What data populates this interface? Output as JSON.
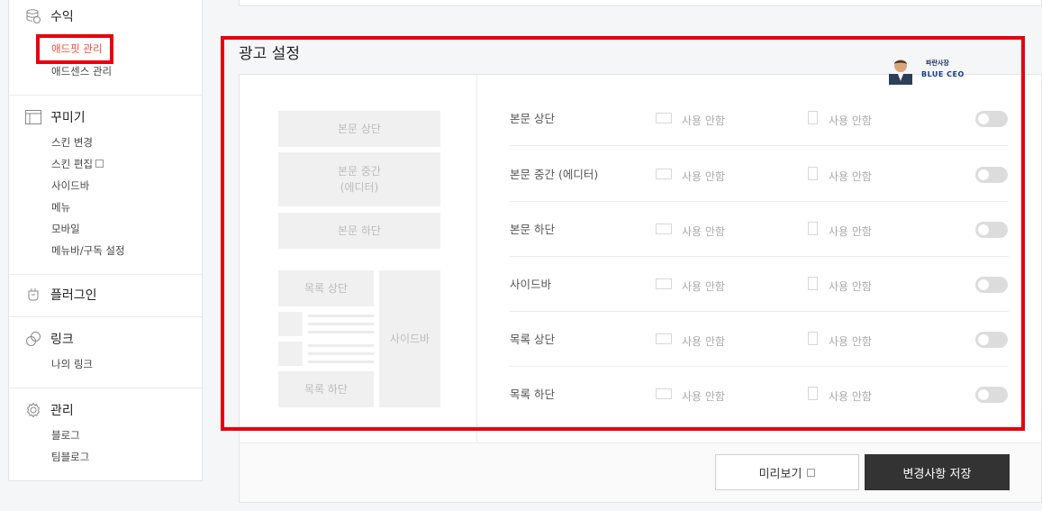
{
  "sidebar": {
    "revenue": {
      "title": "수익",
      "items": [
        "애드핏 관리",
        "애드센스 관리"
      ]
    },
    "decorate": {
      "title": "꾸미기",
      "items": [
        "스킨 변경",
        "스킨 편집",
        "사이드바",
        "메뉴",
        "모바일",
        "메뉴바/구독 설정"
      ]
    },
    "plugin": {
      "title": "플러그인"
    },
    "link": {
      "title": "링크",
      "items": [
        "나의 링크"
      ]
    },
    "manage": {
      "title": "관리",
      "items": [
        "블로그",
        "팀블로그"
      ]
    }
  },
  "main": {
    "title": "광고 설정",
    "layout": {
      "body_top": "본문 상단",
      "body_mid_line1": "본문 중간",
      "body_mid_line2": "(에디터)",
      "body_bottom": "본문 하단",
      "list_top": "목록 상단",
      "list_bottom": "목록 하단",
      "sidebar": "사이드바"
    },
    "rows": [
      {
        "label": "본문 상단",
        "pc": "사용 안함",
        "mobile": "사용 안함",
        "enabled": false
      },
      {
        "label": "본문 중간 (에디터)",
        "pc": "사용 안함",
        "mobile": "사용 안함",
        "enabled": false
      },
      {
        "label": "본문 하단",
        "pc": "사용 안함",
        "mobile": "사용 안함",
        "enabled": false
      },
      {
        "label": "사이드바",
        "pc": "사용 안함",
        "mobile": "사용 안함",
        "enabled": false
      },
      {
        "label": "목록 상단",
        "pc": "사용 안함",
        "mobile": "사용 안함",
        "enabled": false
      },
      {
        "label": "목록 하단",
        "pc": "사용 안함",
        "mobile": "사용 안함",
        "enabled": false
      }
    ],
    "preview_label": "미리보기",
    "save_label": "변경사항 저장"
  },
  "watermark": {
    "line1": "파란사장",
    "line2": "BLUE CEO"
  },
  "colors": {
    "accent_red": "#e8000b",
    "active_link": "#f04b3a",
    "save_button": "#333333"
  }
}
